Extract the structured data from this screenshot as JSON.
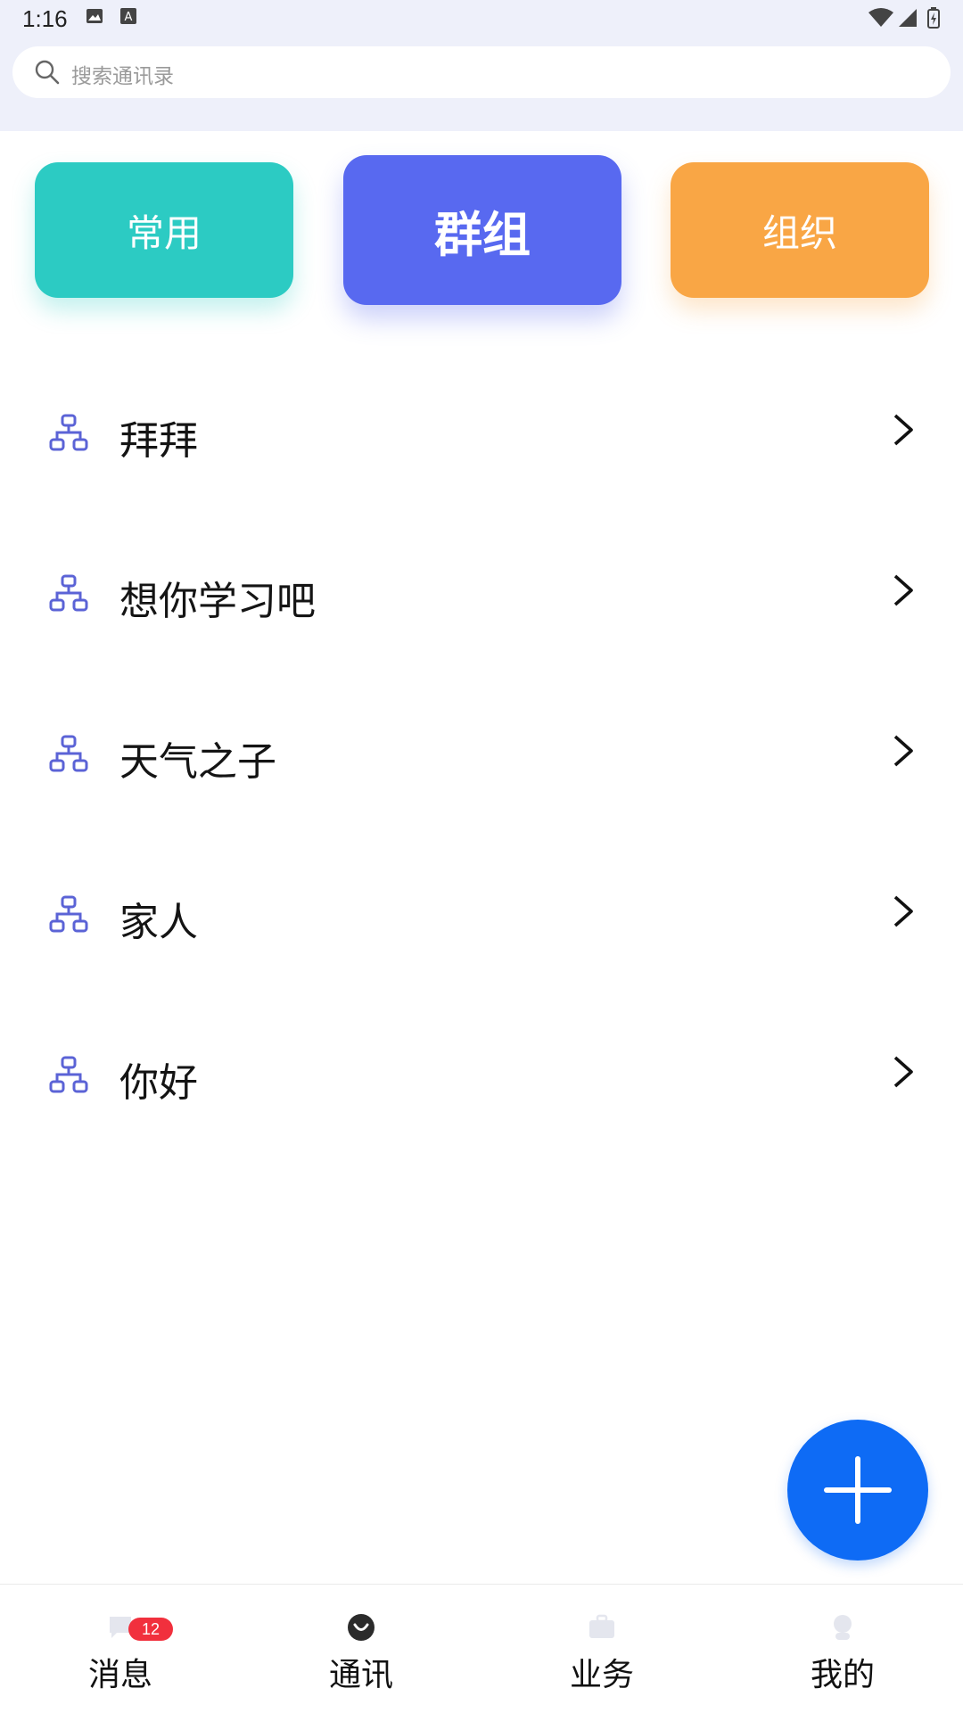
{
  "status_bar": {
    "time": "1:16",
    "icons": [
      "image-icon",
      "a-notification-icon",
      "wifi-icon",
      "signal-icon",
      "battery-icon"
    ]
  },
  "search": {
    "placeholder": "搜索通讯录"
  },
  "segments": {
    "common": "常用",
    "group": "群组",
    "org": "组织",
    "colors": {
      "common": "#2ccbc3",
      "group": "#5869f0",
      "org": "#f9a645"
    }
  },
  "groups": [
    {
      "label": "拜拜"
    },
    {
      "label": "想你学习吧"
    },
    {
      "label": "天气之子"
    },
    {
      "label": "家人"
    },
    {
      "label": "你好"
    }
  ],
  "fab": {
    "icon": "plus-icon",
    "color": "#0e6bf5"
  },
  "bottom_nav": {
    "items": [
      {
        "label": "消息",
        "icon": "message-icon",
        "badge": "12"
      },
      {
        "label": "通讯",
        "icon": "contacts-icon"
      },
      {
        "label": "业务",
        "icon": "briefcase-icon"
      },
      {
        "label": "我的",
        "icon": "profile-icon"
      }
    ]
  }
}
